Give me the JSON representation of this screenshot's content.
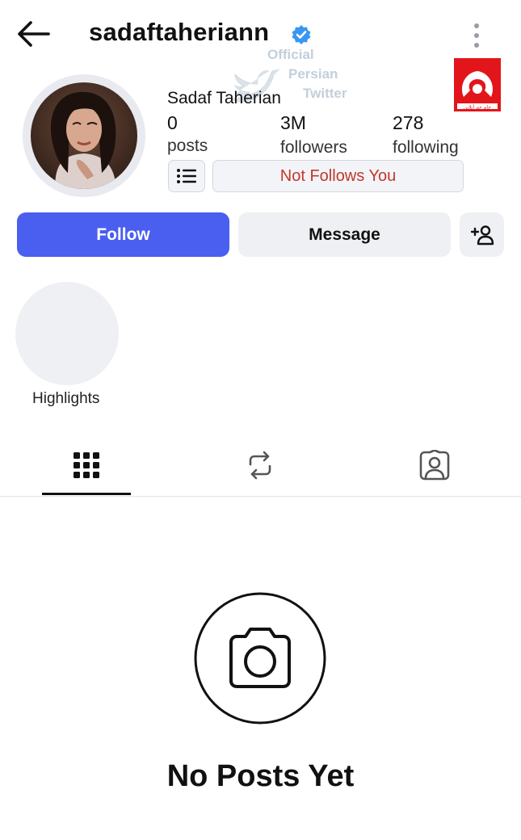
{
  "header": {
    "username": "sadaftaheriann",
    "back_icon": "arrow-left-icon",
    "verified_icon": "verified-badge-icon",
    "more_icon": "more-vertical-icon"
  },
  "watermark": {
    "line1": "Official",
    "line2": "Persian",
    "line3": "Twitter",
    "logo_text": "جام جم آنلاین"
  },
  "profile": {
    "display_name": "Sadaf Taherian",
    "stats": {
      "posts_count": "0",
      "posts_label": "posts",
      "followers_count": "3M",
      "followers_label": "followers",
      "following_count": "278",
      "following_label": "following"
    },
    "follow_status": "Not Follows You"
  },
  "actions": {
    "follow_label": "Follow",
    "message_label": "Message"
  },
  "highlights": {
    "label": "Highlights"
  },
  "tabs": [
    {
      "name": "grid",
      "icon": "grid-icon",
      "active": true
    },
    {
      "name": "reposts",
      "icon": "repost-icon",
      "active": false
    },
    {
      "name": "tagged",
      "icon": "tagged-user-icon",
      "active": false
    }
  ],
  "empty_state": {
    "title": "No Posts Yet",
    "icon": "camera-icon"
  },
  "colors": {
    "follow_button": "#4a5ef0",
    "verified": "#3897f0",
    "status_text": "#c0392b",
    "logo_red": "#e2151b"
  }
}
